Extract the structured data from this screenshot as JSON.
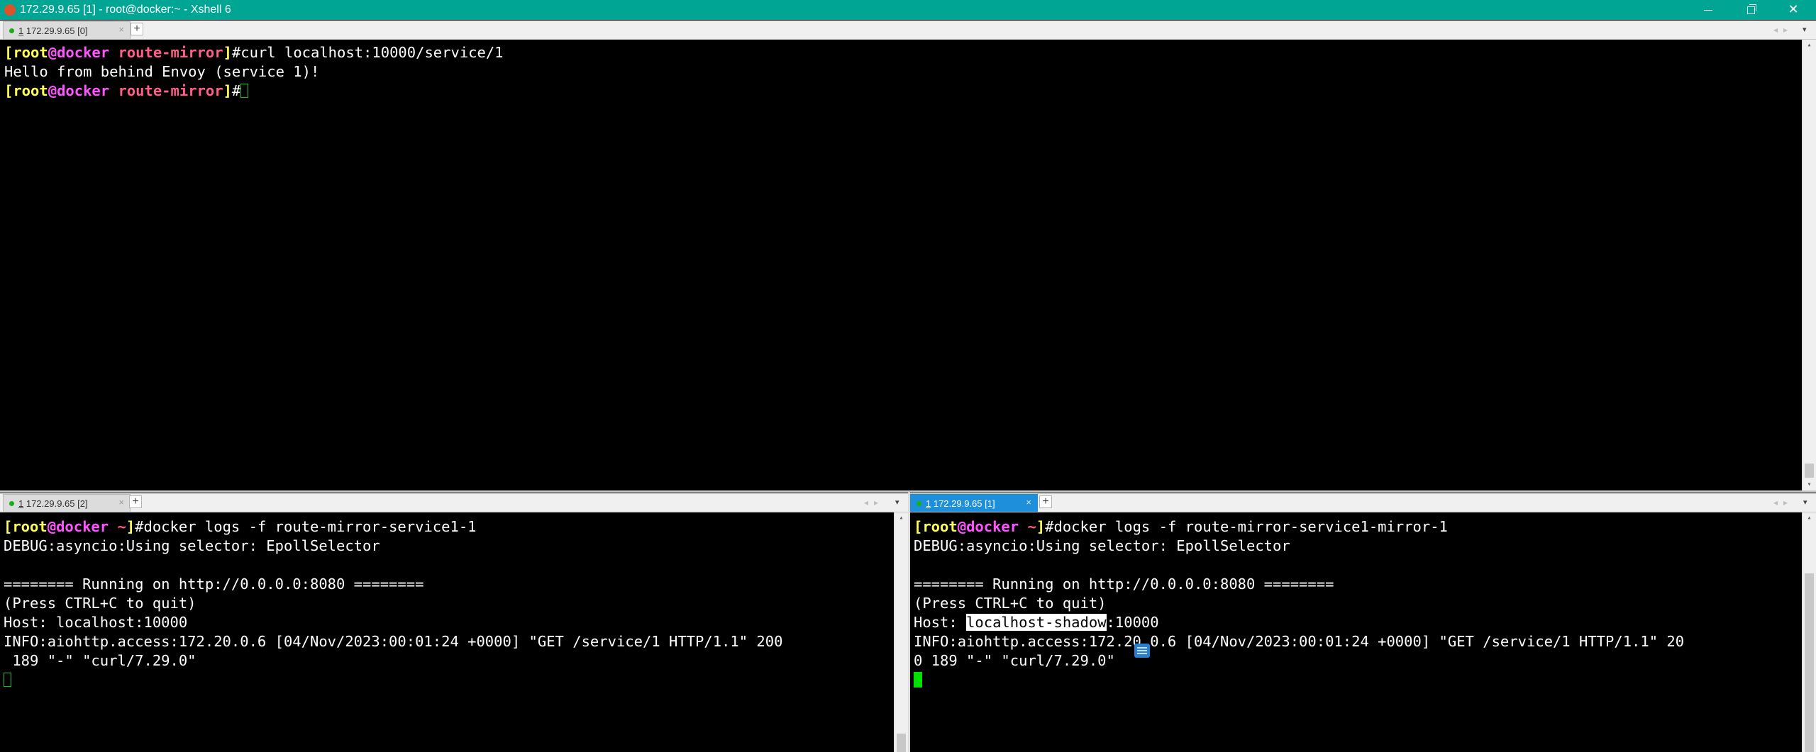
{
  "window": {
    "title": "172.29.9.65 [1] - root@docker:~ - Xshell 6"
  },
  "top_pane": {
    "tab": {
      "prefix": "1",
      "label": " 172.29.9.65 [0]"
    },
    "prompt": {
      "user": "root",
      "at": "@",
      "host": "docker",
      "dir": "route-mirror"
    },
    "command": "curl localhost:10000/service/1",
    "output": "Hello from behind Envoy (service 1)!"
  },
  "bottom_left_pane": {
    "tab": {
      "prefix": "1",
      "label": " 172.29.9.65 [2]"
    },
    "prompt": {
      "user": "root",
      "at": "@",
      "host": "docker",
      "dir": "~"
    },
    "command": "docker logs -f route-mirror-service1-1",
    "lines": [
      "DEBUG:asyncio:Using selector: EpollSelector",
      "",
      "======== Running on http://0.0.0.0:8080 ========",
      "(Press CTRL+C to quit)",
      "Host: localhost:10000",
      "INFO:aiohttp.access:172.20.0.6 [04/Nov/2023:00:01:24 +0000] \"GET /service/1 HTTP/1.1\" 200",
      " 189 \"-\" \"curl/7.29.0\""
    ]
  },
  "bottom_right_pane": {
    "tab": {
      "prefix": "1",
      "label": " 172.29.9.65 [1]"
    },
    "prompt": {
      "user": "root",
      "at": "@",
      "host": "docker",
      "dir": "~"
    },
    "command": "docker logs -f route-mirror-service1-mirror-1",
    "line_debug": "DEBUG:asyncio:Using selector: EpollSelector",
    "line_running": "======== Running on http://0.0.0.0:8080 ========",
    "line_press": "(Press CTRL+C to quit)",
    "host_prefix": "Host: ",
    "host_highlight": "localhost-shadow",
    "host_suffix": ":10000",
    "line_info": "INFO:aiohttp.access:172.20.0.6 [04/Nov/2023:00:01:24 +0000] \"GET /service/1 HTTP/1.1\" 20",
    "line_info_wrap": "0 189 \"-\" \"curl/7.29.0\""
  },
  "symbols": {
    "add_tab": "+",
    "close_tab": "×",
    "close_window": "✕",
    "nav": "◂▸",
    "dropdown": "▾",
    "scroll_up": "▴",
    "scroll_down": "▾",
    "bracket_open": "[",
    "bracket_close": "]",
    "hash": "#"
  },
  "colors": {
    "titlebar": "#00a594",
    "active_tab": "#1e8fdb",
    "prompt_user": "#ffff55",
    "prompt_host": "#ff55ff",
    "prompt_dir": "#ff5f87",
    "cursor": "#00e000"
  }
}
